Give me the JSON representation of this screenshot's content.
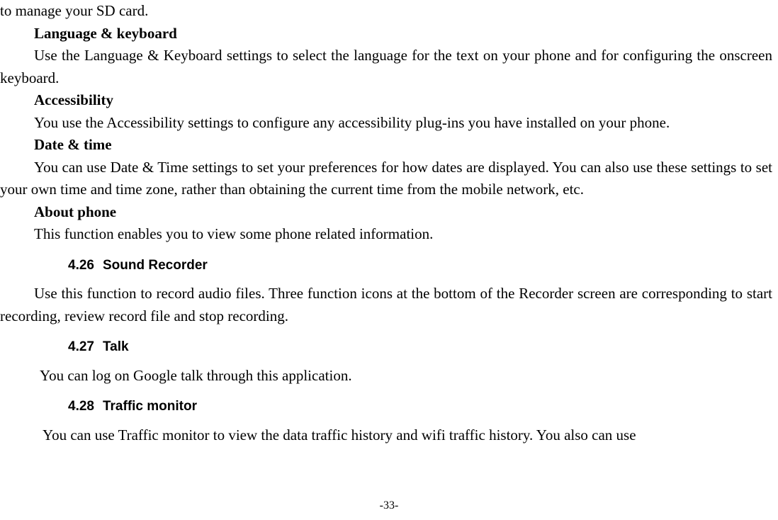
{
  "intro_fragment": "to manage your SD card.",
  "sections": {
    "lang_kb": {
      "title": "Language & keyboard",
      "body": "Use the Language & Keyboard settings to select the language for the text on your phone and for configuring the onscreen keyboard."
    },
    "accessibility": {
      "title": "Accessibility",
      "body": "You use the Accessibility settings to configure any accessibility plug-ins you have installed on your phone."
    },
    "date_time": {
      "title": "Date & time",
      "body": "You can use Date & Time settings to set your preferences for how dates are displayed. You can also use these settings to set your own time and time zone, rather than obtaining the current time from the mobile network, etc."
    },
    "about_phone": {
      "title": "About phone",
      "body": "This function enables you to view some phone related information."
    },
    "sound_recorder": {
      "num": "4.26",
      "title": "Sound Recorder",
      "body": "Use this function to record audio files. Three function icons at the bottom of the Recorder screen are corresponding to start recording, review record file and stop recording."
    },
    "talk": {
      "num": "4.27",
      "title": "Talk",
      "body": "You can log on Google talk through this application."
    },
    "traffic_monitor": {
      "num": "4.28",
      "title": "Traffic monitor",
      "body": "You can use Traffic monitor to view the data traffic history and wifi traffic history. You also can use"
    }
  },
  "page_number": "-33-"
}
